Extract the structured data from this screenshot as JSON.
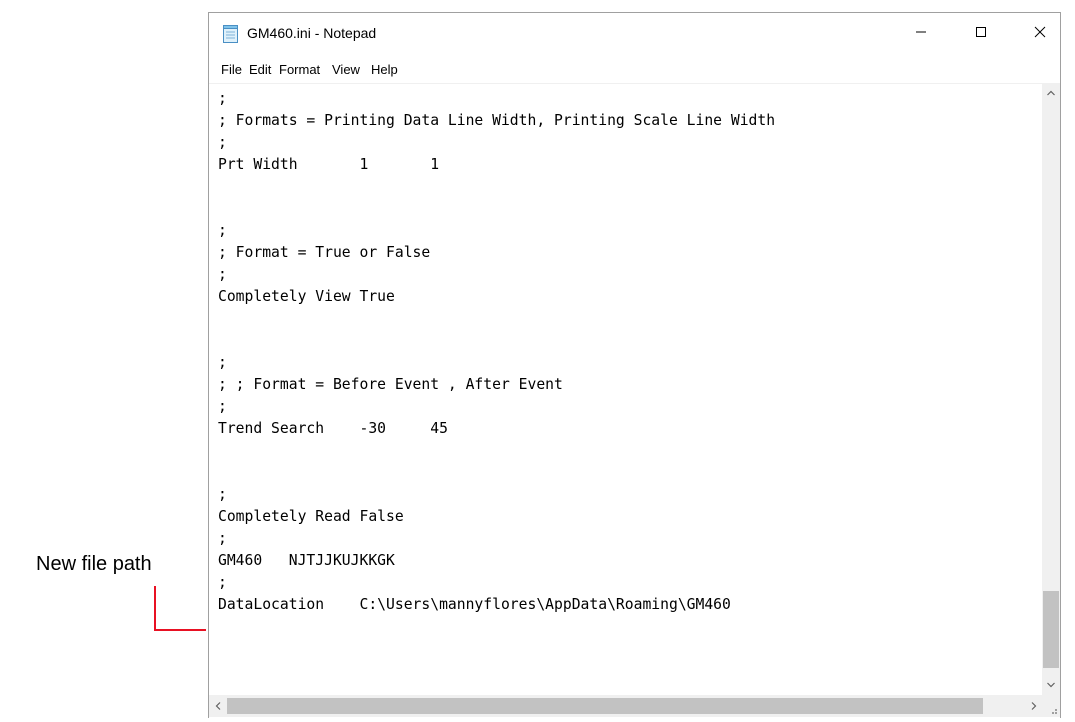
{
  "annotation": {
    "label": "New file path",
    "callout_color": "#e81123"
  },
  "window": {
    "title": "GM460.ini - Notepad",
    "icon": "notepad-icon",
    "controls": {
      "minimize": "minimize-icon",
      "maximize": "maximize-icon",
      "close": "close-icon"
    }
  },
  "menu": [
    "File",
    "Edit",
    "Format",
    "View",
    "Help"
  ],
  "editor": {
    "lines": [
      ";",
      "; Formats = Printing Data Line Width, Printing Scale Line Width",
      ";",
      "Prt Width       1       1",
      "",
      "",
      ";",
      "; Format = True or False",
      ";",
      "Completely View True",
      "",
      "",
      ";",
      "; ; Format = Before Event , After Event",
      ";",
      "Trend Search    -30     45",
      "",
      "",
      ";",
      "Completely Read False",
      ";",
      "GM460   NJTJJKUJKKGK",
      ";",
      "DataLocation    C:\\Users\\mannyflores\\AppData\\Roaming\\GM460"
    ]
  },
  "scrollbars": {
    "vertical": {
      "up": "chevron-up-icon",
      "down": "chevron-down-icon"
    },
    "horizontal": {
      "left": "chevron-left-icon",
      "right": "chevron-right-icon"
    }
  }
}
